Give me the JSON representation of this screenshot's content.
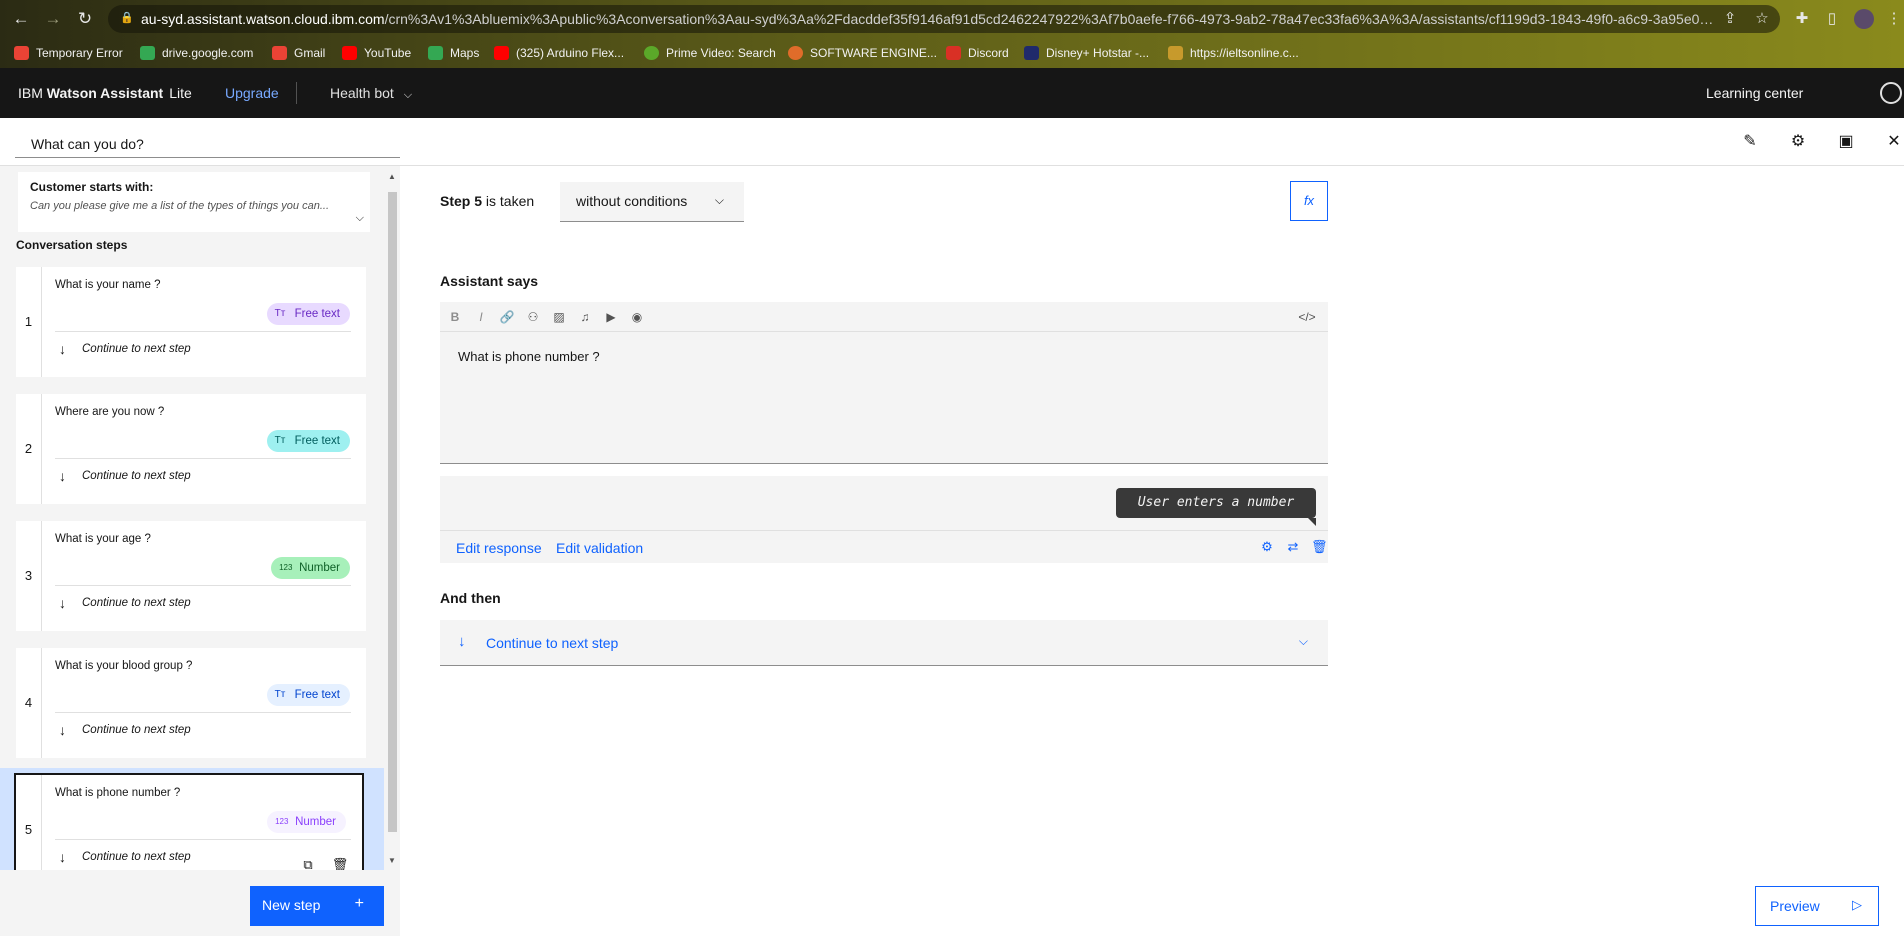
{
  "browser": {
    "url_host": "au-syd.assistant.watson.cloud.ibm.com",
    "url_path": "/crn%3Av1%3Abluemix%3Apublic%3Aconversation%3Aau-syd%3Aa%2Fdacddef35f9146af91d5cd2462247922%3Af7b0aefe-f766-4973-9ab2-78a47ec33fa6%3A%3A/assistants/cf1199d3-1843-49f0-a6c9-3a95e08a3...",
    "bookmarks": [
      {
        "label": "Temporary Error",
        "color": "#ea4335"
      },
      {
        "label": "drive.google.com",
        "color": "#34a853"
      },
      {
        "label": "Gmail",
        "color": "#ea4335"
      },
      {
        "label": "YouTube",
        "color": "#ff0000"
      },
      {
        "label": "Maps",
        "color": "#34a853"
      },
      {
        "label": "(325) Arduino Flex...",
        "color": "#ff0000"
      },
      {
        "label": "Prime Video: Search",
        "color": "#5ba829"
      },
      {
        "label": "SOFTWARE ENGINE...",
        "color": "#e06c2a"
      },
      {
        "label": "Discord",
        "color": "#d93025"
      },
      {
        "label": "Disney+ Hotstar -...",
        "color": "#1f2a6b"
      },
      {
        "label": "https://ieltsonline.c...",
        "color": "#c79a2c"
      }
    ]
  },
  "header": {
    "brand_prefix": "IBM",
    "brand_name": "Watson Assistant",
    "plan": "Lite",
    "upgrade": "Upgrade",
    "bot_name": "Health bot",
    "learning_center": "Learning center"
  },
  "action": {
    "title": "What can you do?"
  },
  "sidebar": {
    "customer_starts_title": "Customer starts with:",
    "customer_starts_text": "Can you please give me a list of the types of things you can...",
    "conversation_steps_label": "Conversation steps",
    "steps": [
      {
        "num": "1",
        "question": "What is your name ?",
        "tag": "Free text",
        "next": "Continue to next step"
      },
      {
        "num": "2",
        "question": "Where are you now ?",
        "tag": "Free text",
        "next": "Continue to next step"
      },
      {
        "num": "3",
        "question": "What is your age ?",
        "tag": "Number",
        "next": "Continue to next step"
      },
      {
        "num": "4",
        "question": "What is your blood group ?",
        "tag": "Free text",
        "next": "Continue to next step"
      },
      {
        "num": "5",
        "question": "What is phone number ?",
        "tag": "Number",
        "next": "Continue to next step"
      }
    ],
    "new_step_label": "New step"
  },
  "editor": {
    "step_label": "Step 5",
    "is_taken": "is taken",
    "condition": "without conditions",
    "fx_label": "fx",
    "assistant_says_label": "Assistant says",
    "message": "What is phone number ?",
    "user_response": "User enters a number",
    "edit_response": "Edit response",
    "edit_validation": "Edit validation",
    "and_then_label": "And then",
    "and_then_value": "Continue to next step"
  },
  "preview_label": "Preview"
}
